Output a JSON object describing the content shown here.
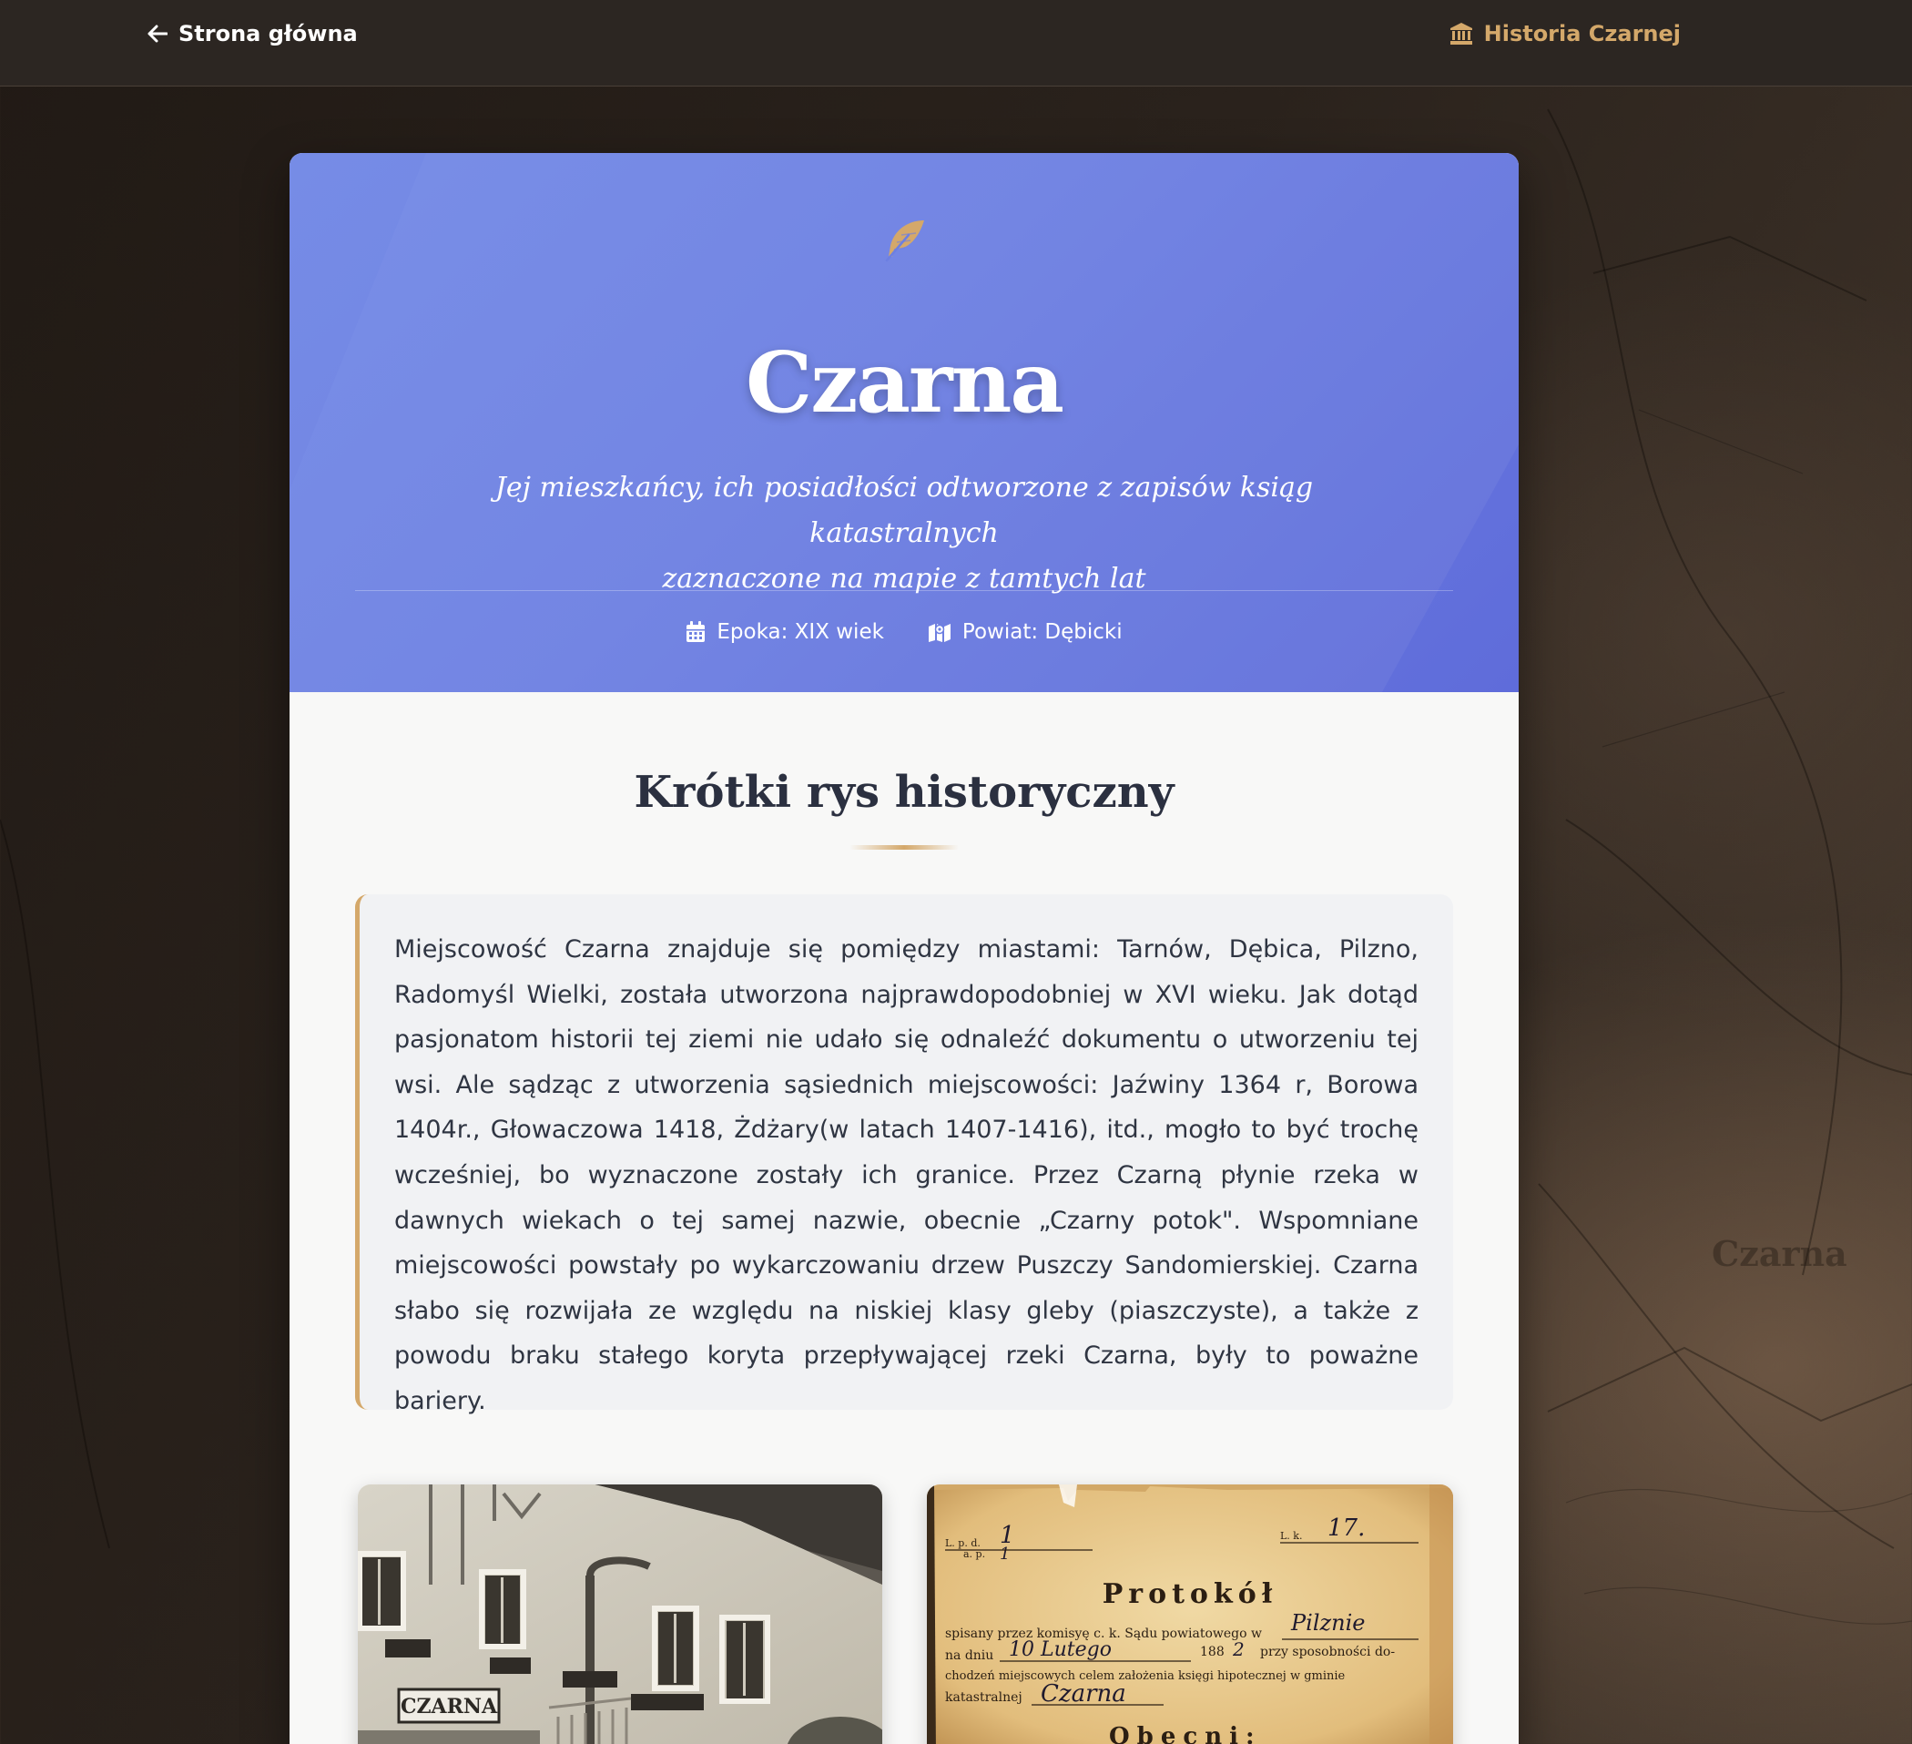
{
  "nav": {
    "back_label": "Strona główna",
    "brand_label": "Historia Czarnej"
  },
  "hero": {
    "icon": "feather-icon",
    "title": "Czarna",
    "subtitle_line1": "Jej mieszkańcy, ich posiadłości odtworzone z zapisów ksiąg katastralnych",
    "subtitle_line2": "zaznaczone na mapie z tamtych lat",
    "meta": [
      {
        "icon": "calendar-icon",
        "label": "Epoka: XIX wiek"
      },
      {
        "icon": "map-icon",
        "label": "Powiat: Dębicki"
      }
    ]
  },
  "history": {
    "title": "Krótki rys historyczny",
    "text": "Miejscowość Czarna znajduje się pomiędzy miastami: Tarnów, Dębica, Pilzno, Radomyśl Wielki, została utworzona najprawdopodobniej w XVI wieku. Jak dotąd pasjonatom historii tej ziemi nie udało się odnaleźć dokumentu o utworzeniu tej wsi. Ale sądząc z utworzenia sąsiednich miejscowości: Jaźwiny 1364 r, Borowa 1404r., Głowaczowa 1418, Żdżary(w latach 1407-1416), itd., mogło to być trochę wcześniej, bo wyznaczone zostały ich granice. Przez Czarną płynie rzeka w dawnych wiekach o tej samej nazwie, obecnie „Czarny potok\". Wspomniane miejscowości powstały po wykarczowaniu drzew Puszczy Sandomierskiej. Czarna słabo się rozwijała ze względu na niskiej klasy gleby (piaszczyste), a także z powodu braku stałego koryta przepływającej rzeki Czarna, były to poważne bariery."
  },
  "photos": {
    "left": {
      "sign_text": "CZARNA"
    },
    "right": {
      "lp_label": "L. p. d.",
      "lp_value": "1",
      "ap_label": "a. p.",
      "ap_value": "1",
      "lk_label": "L. k.",
      "lk_value": "17.",
      "title": "Protokół",
      "line1_print": "spisany przez komisyę c. k. Sądu powiatowego w",
      "line1_hand": "Pilznie",
      "line2_print_a": "na dniu",
      "line2_hand": "10 Lutego",
      "line2_print_b": "188",
      "line2_hand_b": "2",
      "line2_print_c": "przy sposobności do-",
      "line3_print": "chodzeń miejscowych celem założenia księgi hipotecznej w gminie",
      "line4_print": "katastralnej",
      "line4_hand": "Czarna",
      "line5_print": "Obecni:"
    }
  },
  "background": {
    "map_labels": [
      "Czarna"
    ]
  },
  "colors": {
    "accent_gold": "#d4a86a",
    "hero_blue": "#6c7fe2",
    "nav_bg": "#2c2622",
    "text_dark": "#2b3040"
  }
}
